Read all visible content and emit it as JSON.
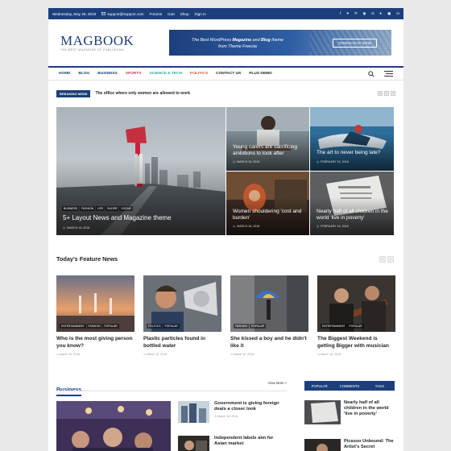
{
  "topbar": {
    "date": "Wednesday, May 29, 2019",
    "email": "support@support.com",
    "links": [
      "Forums",
      "Cart",
      "Shop",
      "Sign In"
    ],
    "social_icons": [
      "facebook-icon",
      "twitter-icon",
      "pinterest-icon",
      "dribbble-icon",
      "instagram-icon",
      "flickr-icon",
      "instagram-icon",
      "linkedin-icon"
    ]
  },
  "logo": {
    "title": "MAGBOOK",
    "subtitle": "THE BEST MAGAZINE OF PUBLISHING"
  },
  "ad": {
    "line1_a": "The Best WordPress ",
    "line1_b": "Magazine",
    "line1_c": " and ",
    "line1_d": "Blog",
    "line1_e": " theme",
    "line2": "from Theme Freesia",
    "button": "DOWNLOAD NOW"
  },
  "nav": {
    "items": [
      {
        "label": "HOME",
        "color": "#1c3f7c"
      },
      {
        "label": "BLOG",
        "color": "#1c3f7c"
      },
      {
        "label": "BUSINESS",
        "color": "#1c3f7c"
      },
      {
        "label": "SPORTS",
        "color": "#d6336c"
      },
      {
        "label": "SCIENCE & TECH",
        "color": "#23a6b5"
      },
      {
        "label": "POLITICS",
        "color": "#e8552b"
      },
      {
        "label": "CONTACT US",
        "color": "#222222"
      },
      {
        "label": "PLUS DEMO",
        "color": "#222222"
      }
    ]
  },
  "breaking": {
    "label": "BREAKING NEWS",
    "text": "The office where only women are allowed to work"
  },
  "hero": {
    "main": {
      "categories": [
        "BUSINESS",
        "FASHION",
        "LIFE",
        "SLIDER",
        "VOGUE"
      ],
      "title": "5+ Layout News and Magazine theme",
      "date": "MARCH 16, 2018"
    },
    "tiles": [
      {
        "title": "Young carers are sacrificing ambitions to look after",
        "date": "MARCH 16, 2018"
      },
      {
        "title": "The art to never being late?",
        "date": "FEBRUARY 16, 2018"
      },
      {
        "title": "Women shouldering 'cost and burden'",
        "date": "MARCH 16, 2018"
      },
      {
        "title": "Nearly half of all children in the world 'live in poverty'",
        "date": "FEBRUARY 16, 2018"
      }
    ]
  },
  "featured": {
    "title": "Today's Feature News",
    "items": [
      {
        "categories": [
          "ENTERTAINMENT",
          "FASHION",
          "POPULAR"
        ],
        "title": "Who is the most giving person you know?",
        "date": "March 16, 2018"
      },
      {
        "categories": [
          "POLITICS",
          "POPULAR"
        ],
        "title": "Plastic particles found in bottled water",
        "date": "March 16, 2018"
      },
      {
        "categories": [
          "FASHION",
          "POPULAR"
        ],
        "title": "She kissed a boy and he didn't like it",
        "date": "March 16, 2018"
      },
      {
        "categories": [
          "ENTERTAINMENT",
          "POPULAR"
        ],
        "title": "The Biggest Weekend is getting Bigger with musician",
        "date": "March 16, 2018"
      }
    ]
  },
  "business": {
    "title": "Business",
    "view_more": "View More »",
    "list": [
      {
        "title": "Government is giving foreign deals a closer look",
        "date": "March 16, 2018"
      },
      {
        "title": "Independent labels aim for Asian market",
        "date": ""
      }
    ]
  },
  "sidebar": {
    "tabs": [
      "POPULAR",
      "COMMENTS",
      "TAGS"
    ],
    "items": [
      {
        "title": "Nearly half of all children in the world 'live in poverty'"
      },
      {
        "title": "Picasso Unbound: The Artist's Secret"
      }
    ]
  },
  "colors": {
    "brand": "#1c3f7c"
  }
}
